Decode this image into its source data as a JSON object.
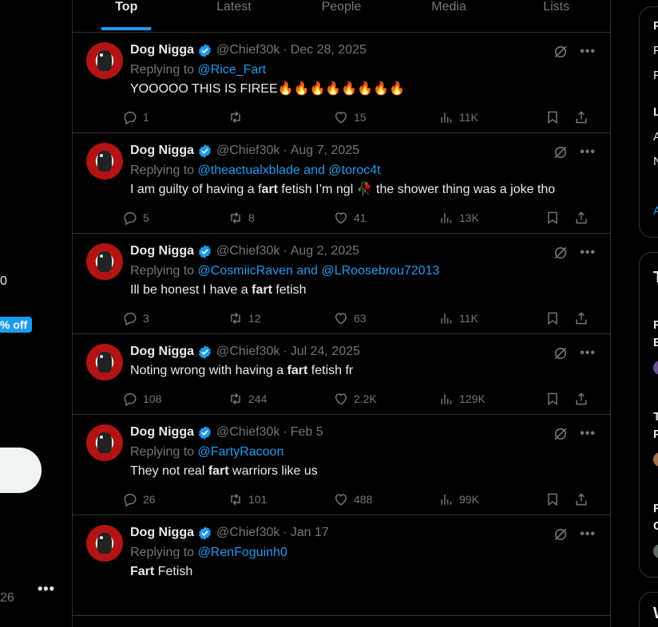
{
  "left": {
    "digit": "0",
    "badge": "% off",
    "count": "26",
    "more": "•••"
  },
  "tabs": [
    {
      "label": "Top",
      "active": true
    },
    {
      "label": "Latest"
    },
    {
      "label": "People"
    },
    {
      "label": "Media"
    },
    {
      "label": "Lists"
    }
  ],
  "tweets": [
    {
      "name": "Dog Nigga",
      "handle": "@Chief30k",
      "date": "Dec 28, 2025",
      "reply_prefix": "Replying to ",
      "reply_links": "@Rice_Fart",
      "text_html": "YOOOOO THIS IS FIREE🔥🔥🔥🔥🔥🔥🔥🔥",
      "replies": "1",
      "reposts": "",
      "likes": "15",
      "views": "11K"
    },
    {
      "name": "Dog Nigga",
      "handle": "@Chief30k",
      "date": "Aug 7, 2025",
      "reply_prefix": "Replying to ",
      "reply_links": "@theactualxblade and @toroc4t",
      "text_a": "I am guilty of having a f",
      "text_b": "art",
      "text_c": " fetish I’m ngl 🥀 the shower thing was a joke tho",
      "replies": "5",
      "reposts": "8",
      "likes": "41",
      "views": "13K"
    },
    {
      "name": "Dog Nigga",
      "handle": "@Chief30k",
      "date": "Aug 2, 2025",
      "reply_prefix": "Replying to ",
      "reply_links": "@CosmiicRaven and @LRoosebrou72013",
      "text_a": "Ill be honest I have a ",
      "text_b": "fart",
      "text_c": " fetish",
      "replies": "3",
      "reposts": "12",
      "likes": "63",
      "views": "11K"
    },
    {
      "name": "Dog Nigga",
      "handle": "@Chief30k",
      "date": "Jul 24, 2025",
      "text_a": "Noting wrong with having a ",
      "text_b": "fart",
      "text_c": " fetish fr",
      "replies": "108",
      "reposts": "244",
      "likes": "2.2K",
      "views": "129K"
    },
    {
      "name": "Dog Nigga",
      "handle": "@Chief30k",
      "date": "Feb 5",
      "reply_prefix": "Replying to ",
      "reply_links": "@FartyRacoon",
      "text_a": "They not real ",
      "text_b": "fart",
      "text_c": " warriors like us",
      "replies": "26",
      "reposts": "101",
      "likes": "488",
      "views": "99K"
    },
    {
      "name": "Dog Nigga",
      "handle": "@Chief30k",
      "date": "Jan 17",
      "reply_prefix": "Replying to ",
      "reply_links": "@RenFoguinh0",
      "text_a": "",
      "text_b": "Fart",
      "text_c": " Fetish"
    }
  ],
  "dot_sep": "·",
  "more_label": "•••",
  "right": {
    "letters1": [
      "P",
      "F",
      "F",
      "L",
      "A",
      "N",
      "A"
    ],
    "letters2": [
      "T",
      "F",
      "E",
      "T",
      "P",
      "F",
      "C"
    ],
    "letter3": "W"
  },
  "colors": {
    "accent": "#1d9bf0",
    "border": "#2f3336",
    "muted": "#71767b"
  }
}
